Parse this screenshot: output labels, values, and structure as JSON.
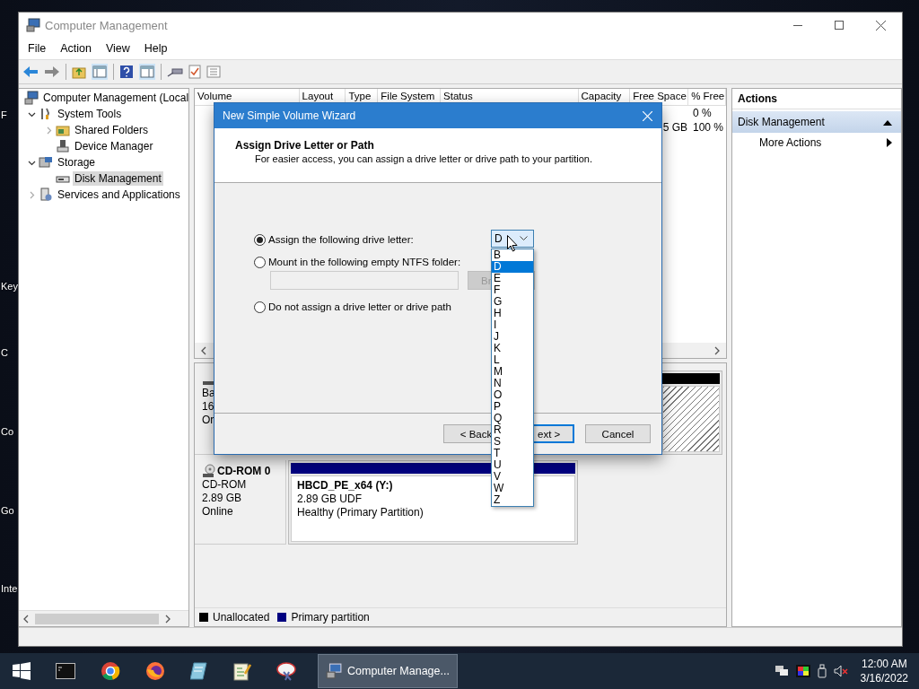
{
  "desktop_labels": [
    "F",
    "Key",
    "C",
    "Co",
    "Go",
    "Inte"
  ],
  "window": {
    "title": "Computer Management"
  },
  "menu": [
    "File",
    "Action",
    "View",
    "Help"
  ],
  "tree": [
    {
      "label": "Computer Management (Local",
      "selected": false,
      "children": [
        {
          "label": "System Tools",
          "expanded": true,
          "selected": false,
          "children": [
            {
              "label": "Shared Folders",
              "expanded": false,
              "selected": false
            },
            {
              "label": "Device Manager",
              "selected": false
            }
          ]
        },
        {
          "label": "Storage",
          "expanded": true,
          "selected": false,
          "children": [
            {
              "label": "Disk Management",
              "selected": true
            }
          ]
        },
        {
          "label": "Services and Applications",
          "expanded": false,
          "selected": false
        }
      ]
    }
  ],
  "volume_list": {
    "columns": [
      "Volume",
      "Layout",
      "Type",
      "File System",
      "Status",
      "Capacity",
      "Free Space",
      "% Free"
    ],
    "rows": [
      {
        "pct_free": "0 %"
      },
      {
        "free_space": "5 GB",
        "pct_free": "100 %"
      }
    ]
  },
  "disks": [
    {
      "lines": [
        "Ba",
        "16",
        "Or"
      ],
      "partition": {
        "kind": "unallocated"
      }
    },
    {
      "name": "CD-ROM 0",
      "lines": [
        "CD-ROM",
        "2.89 GB",
        "Online"
      ],
      "partition": {
        "kind": "primary",
        "name": "HBCD_PE_x64  (Y:)",
        "lines": [
          "2.89 GB UDF",
          "Healthy (Primary Partition)"
        ]
      }
    }
  ],
  "legend": [
    {
      "label": "Unallocated",
      "color": "#000000"
    },
    {
      "label": "Primary partition",
      "color": "#000080"
    }
  ],
  "actions": {
    "title": "Actions",
    "section": "Disk Management",
    "expanded": true,
    "items": [
      "More Actions"
    ]
  },
  "dialog": {
    "title": "New Simple Volume Wizard",
    "heading": "Assign Drive Letter or Path",
    "subtitle": "For easier access, you can assign a drive letter or drive path to your partition.",
    "options": [
      {
        "label": "Assign the following drive letter:",
        "selected": true
      },
      {
        "label": "Mount in the following empty NTFS folder:",
        "selected": false
      },
      {
        "label": "Do not assign a drive letter or drive path",
        "selected": false
      }
    ],
    "folder_field": {
      "disabled": true
    },
    "browse_button": {
      "label": "Br",
      "disabled": true
    },
    "drive_letter": {
      "value": "D",
      "open": true,
      "options": [
        {
          "label": "B",
          "selected": false
        },
        {
          "label": "D",
          "selected": true
        },
        {
          "label": "E",
          "selected": false
        },
        {
          "label": "F",
          "selected": false
        },
        {
          "label": "G",
          "selected": false
        },
        {
          "label": "H",
          "selected": false
        },
        {
          "label": "I",
          "selected": false
        },
        {
          "label": "J",
          "selected": false
        },
        {
          "label": "K",
          "selected": false
        },
        {
          "label": "L",
          "selected": false
        },
        {
          "label": "M",
          "selected": false
        },
        {
          "label": "N",
          "selected": false
        },
        {
          "label": "O",
          "selected": false
        },
        {
          "label": "P",
          "selected": false
        },
        {
          "label": "Q",
          "selected": false
        },
        {
          "label": "R",
          "selected": false
        },
        {
          "label": "S",
          "selected": false
        },
        {
          "label": "T",
          "selected": false
        },
        {
          "label": "U",
          "selected": false
        },
        {
          "label": "V",
          "selected": false
        },
        {
          "label": "W",
          "selected": false
        },
        {
          "label": "Z",
          "selected": false
        }
      ]
    },
    "buttons": [
      {
        "label": "< Back",
        "default": false
      },
      {
        "label": "ext >",
        "default": true
      },
      {
        "label": "Cancel",
        "default": false
      }
    ]
  },
  "taskbar": {
    "apps": [
      {
        "kind": "terminal"
      },
      {
        "kind": "chrome"
      },
      {
        "kind": "firefox"
      },
      {
        "kind": "notepad"
      },
      {
        "kind": "editor"
      },
      {
        "kind": "paint"
      }
    ],
    "active_window": {
      "label": "Computer Manage..."
    },
    "tray": [
      {
        "kind": "network"
      },
      {
        "kind": "color"
      },
      {
        "kind": "usb"
      },
      {
        "kind": "volume-muted"
      }
    ],
    "clock": {
      "time": "12:00 AM",
      "date": "3/16/2022"
    }
  }
}
